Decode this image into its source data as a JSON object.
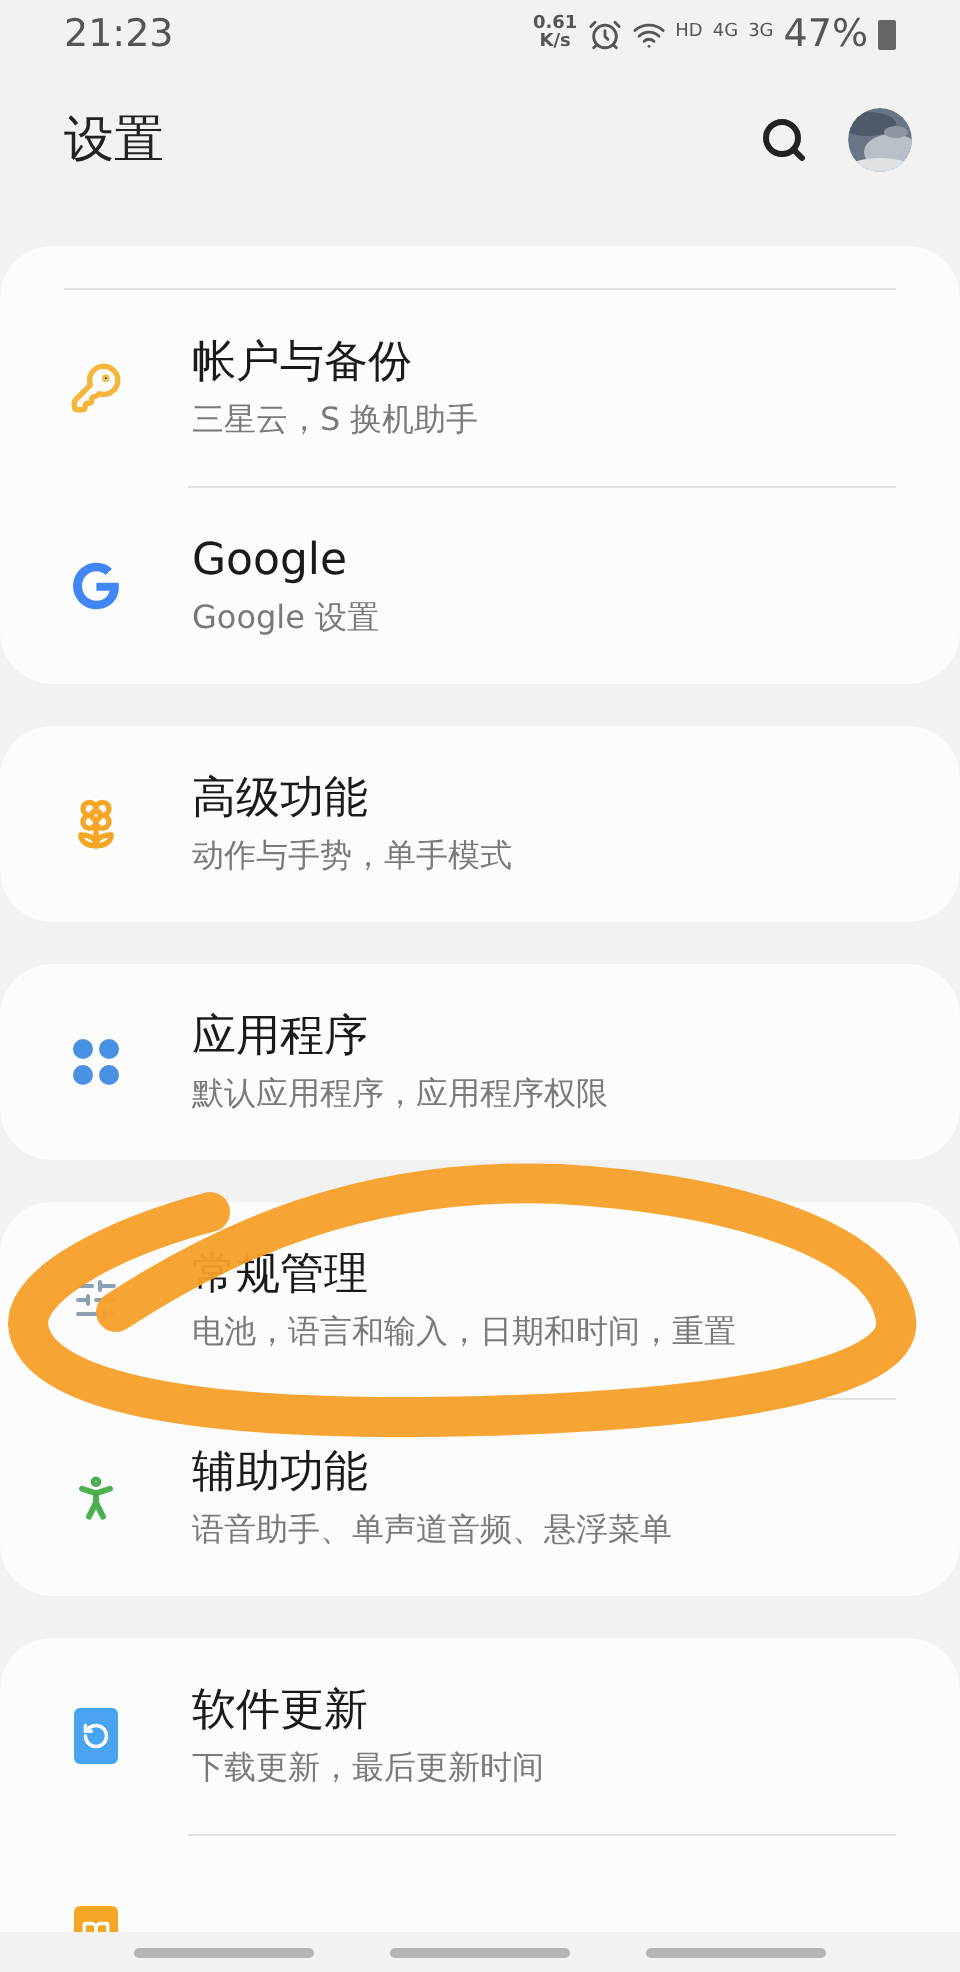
{
  "status_bar": {
    "time": "21:23",
    "net_speed_value": "0.61",
    "net_speed_unit": "K/s",
    "hd_label": "HD",
    "sim1_label": "4G",
    "sim2_label": "3G",
    "battery": "47%"
  },
  "header": {
    "title": "设置"
  },
  "sections": [
    {
      "items": [
        {
          "title": "帐户与备份",
          "subtitle": "三星云，S 换机助手"
        },
        {
          "title": "Google",
          "subtitle": "Google 设置"
        }
      ]
    },
    {
      "items": [
        {
          "title": "高级功能",
          "subtitle": "动作与手势，单手模式"
        }
      ]
    },
    {
      "items": [
        {
          "title": "应用程序",
          "subtitle": "默认应用程序，应用程序权限"
        }
      ]
    },
    {
      "items": [
        {
          "title": "常规管理",
          "subtitle": "电池，语言和输入，日期和时间，重置"
        },
        {
          "title": "辅助功能",
          "subtitle": "语音助手、单声道音频、悬浮菜单"
        }
      ]
    },
    {
      "items": [
        {
          "title": "软件更新",
          "subtitle": "下载更新，最后更新时间"
        }
      ],
      "more_below": true
    }
  ]
}
